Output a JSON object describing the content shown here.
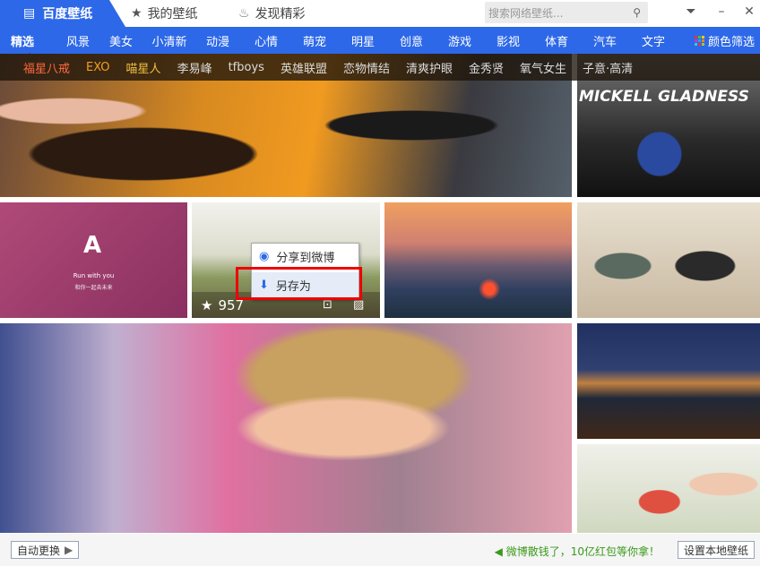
{
  "app": {
    "title": "百度壁纸"
  },
  "title_tabs": [
    {
      "label": "我的壁纸",
      "icon": "star-icon"
    },
    {
      "label": "发现精彩",
      "icon": "flame-icon"
    }
  ],
  "search": {
    "placeholder": "搜索网络壁纸..."
  },
  "nav": {
    "items": [
      "精选",
      "风景",
      "美女",
      "小清新",
      "动漫",
      "心情",
      "萌宠",
      "明星",
      "创意",
      "游戏",
      "影视",
      "体育",
      "汽车",
      "文字"
    ],
    "active": "精选",
    "color_filter": "颜色筛选"
  },
  "tags": [
    {
      "label": "福星八戒",
      "color": "#ff6a3d"
    },
    {
      "label": "EXO",
      "color": "#f0a020"
    },
    {
      "label": "喵星人",
      "color": "#f0c040"
    },
    {
      "label": "李易峰"
    },
    {
      "label": "tfboys"
    },
    {
      "label": "英雄联盟"
    },
    {
      "label": "恋物情结"
    },
    {
      "label": "清爽护眼"
    },
    {
      "label": "金秀贤"
    },
    {
      "label": "氧气女生"
    },
    {
      "label": "子意·高清"
    }
  ],
  "tiles": {
    "poster_text": "MICKELL GLADNESS",
    "card_title": "Run with you",
    "card_sub": "和你一起去未来",
    "like_count": "957"
  },
  "context_menu": {
    "items": [
      "分享到微博",
      "另存为"
    ],
    "highlighted": "另存为"
  },
  "footer": {
    "auto_change": "自动更换",
    "promo": "微博散钱了，10亿红包等你拿！",
    "set_local": "设置本地壁纸"
  }
}
